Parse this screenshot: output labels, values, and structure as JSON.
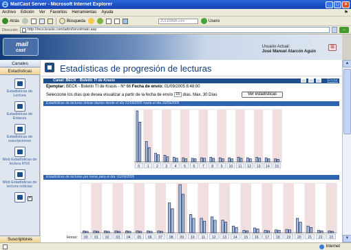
{
  "window": {
    "title": "MailCast Server - Microsoft Internet Explorer",
    "buttons": [
      "_",
      "□",
      "×"
    ]
  },
  "menu": [
    "Archivo",
    "Edición",
    "Ver",
    "Favoritos",
    "Herramientas",
    "Ayuda"
  ],
  "toolbar": {
    "back": "Atrás",
    "search": "Búsqueda",
    "field": "ZULEMMA.com",
    "users": "Usero"
  },
  "address": {
    "label": "Dirección",
    "url": "http://mcs.krasis.com/adm/lrevsimain.asp"
  },
  "header": {
    "logo_top": "mail",
    "logo_bottom": "cast",
    "user_label": "Usuario Actual:",
    "user_name": "José Manuel Alarcón Aguín"
  },
  "sidebar": {
    "tab_canales": "Canales",
    "tab_estadisticas": "Estadísticas",
    "items": [
      {
        "label": "Estadísticas de Lectura"
      },
      {
        "label": "Estadísticas de Enlaces"
      },
      {
        "label": "Estadísticas de suscripciones"
      },
      {
        "label": "Web Estadísticas de lectura RSS"
      },
      {
        "label": "Web Estadísticas de lectura noticias"
      }
    ],
    "expander": "+",
    "footer": "Suscriptores"
  },
  "page": {
    "title": "Estadísticas de progresión de lecturas",
    "channel_bar": "Canal: BECK - Boletín TI de Krasis",
    "send_link": "Enviar",
    "example_label": "Ejemplar:",
    "example_value": " BECK - Boletín TI de Krasis - Nº 66 ",
    "date_label": "Fecha de envío:",
    "date_value": " 01/09/2005 8:48:00",
    "days_prefix": "Seleccione los días que desea visualizar a partir de la fecha de envío",
    "days_value": "15",
    "days_suffix": "días. Max. 30 Días",
    "view_button": "Ver estadísticas",
    "section1": "Estadísticas de lecturas únicas diarias desde el día 01/09/2005 hasta el día 16/09/2005",
    "section2": "Estadísticas de lecturas por horas para el día: 01/09/2005",
    "hours_label": "Horas:"
  },
  "status": {
    "zone": "Internet"
  },
  "colors": {
    "bar_fill": "#a9c3e6",
    "bar_stroke": "#1a2a55",
    "band": "#f1dede",
    "accent": "#1f4e8c"
  },
  "chart_data": [
    {
      "type": "bar",
      "title": "Estadísticas de lecturas únicas diarias desde el día 01/09/2005 hasta el día 16/09/2005",
      "categories": [
        "0",
        "1",
        "2",
        "3",
        "4",
        "5",
        "6",
        "7",
        "8",
        "9",
        "10",
        "11",
        "12",
        "13",
        "14",
        "15"
      ],
      "series": [
        {
          "values": [
            100,
            40,
            17,
            13,
            9,
            8,
            7,
            8,
            9,
            8,
            8,
            9,
            8,
            9,
            8,
            6
          ]
        },
        {
          "values": [
            78,
            28,
            14,
            10,
            7,
            6,
            6,
            7,
            7,
            6,
            6,
            7,
            6,
            7,
            6,
            5
          ]
        }
      ],
      "ylim": [
        0,
        100
      ]
    },
    {
      "type": "bar",
      "title": "Estadísticas de lecturas por horas para el día: 01/09/2005",
      "xlabel": "Horas:",
      "categories": [
        "00",
        "01",
        "02",
        "03",
        "04",
        "05",
        "06",
        "07",
        "08",
        "09",
        "10",
        "11",
        "12",
        "13",
        "14",
        "15",
        "16",
        "17",
        "18",
        "19",
        "20",
        "21",
        "22",
        "23"
      ],
      "series": [
        {
          "values": [
            4,
            4,
            4,
            4,
            4,
            4,
            4,
            4,
            62,
            100,
            38,
            30,
            33,
            26,
            14,
            5,
            10,
            5,
            6,
            7,
            30,
            14,
            5,
            4
          ]
        },
        {
          "values": [
            3,
            3,
            3,
            3,
            3,
            3,
            3,
            3,
            50,
            80,
            30,
            24,
            26,
            22,
            11,
            4,
            8,
            4,
            5,
            6,
            22,
            11,
            4,
            3
          ]
        }
      ],
      "ylim": [
        0,
        100
      ]
    }
  ]
}
